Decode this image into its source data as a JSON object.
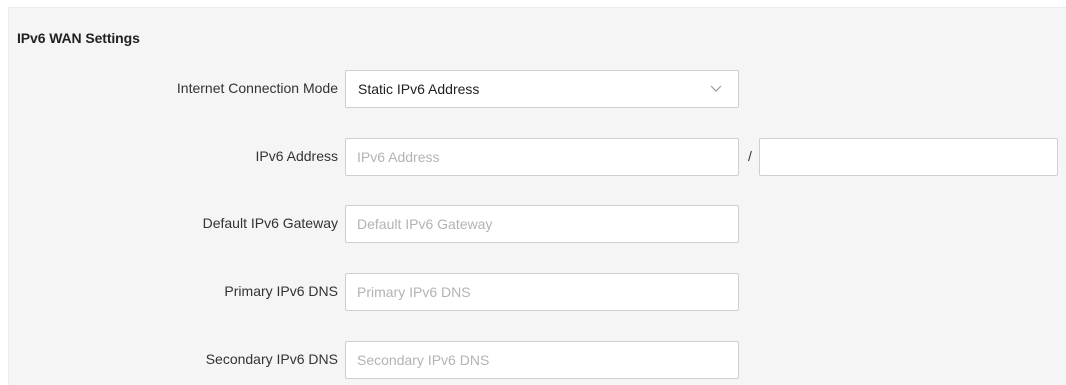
{
  "section": {
    "title": "IPv6 WAN Settings"
  },
  "connection_mode": {
    "label": "Internet Connection Mode",
    "selected": "Static IPv6 Address",
    "icon": "chevron-down-icon"
  },
  "ipv6_address": {
    "label": "IPv6 Address",
    "placeholder": "IPv6 Address",
    "value": "",
    "separator": "/",
    "prefix_value": ""
  },
  "default_gateway": {
    "label": "Default IPv6 Gateway",
    "placeholder": "Default IPv6 Gateway",
    "value": ""
  },
  "primary_dns": {
    "label": "Primary IPv6 DNS",
    "placeholder": "Primary IPv6 DNS",
    "value": ""
  },
  "secondary_dns": {
    "label": "Secondary IPv6 DNS",
    "placeholder": "Secondary IPv6 DNS",
    "value": ""
  }
}
